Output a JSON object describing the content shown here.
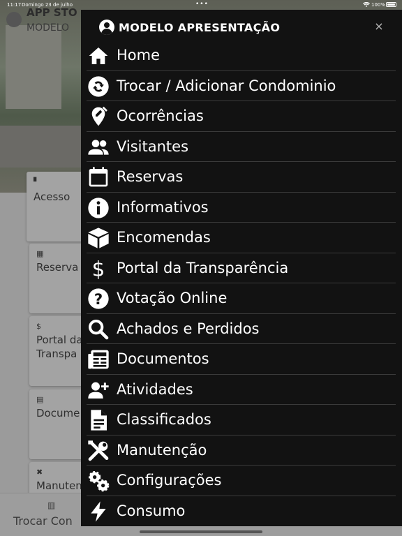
{
  "status_bar": {
    "time": "11:17",
    "date": "Domingo 23 de julho",
    "dots": "•••",
    "battery": "100%"
  },
  "background": {
    "app_title": "APP STO",
    "subtitle": "MODELO",
    "cards": [
      {
        "icon": "door-icon",
        "label": "Acesso"
      },
      {
        "icon": "calendar-icon",
        "label": "Reserva"
      },
      {
        "icon": "dollar-icon",
        "label": "Portal da\nTranspa"
      },
      {
        "icon": "document-icon",
        "label": "Docume"
      },
      {
        "icon": "tools-icon",
        "label": "Manuten"
      }
    ],
    "bottom_bar": {
      "label": "Trocar Con",
      "icon": "buildings-icon"
    }
  },
  "drawer": {
    "title": "MODELO APRESENTAÇÃO",
    "close": "×",
    "items": [
      {
        "label": "Home",
        "icon": "home-icon"
      },
      {
        "label": "Trocar / Adicionar Condominio",
        "icon": "swap-icon"
      },
      {
        "label": "Ocorrências",
        "icon": "location-edit-icon"
      },
      {
        "label": "Visitantes",
        "icon": "people-icon"
      },
      {
        "label": "Reservas",
        "icon": "calendar-icon"
      },
      {
        "label": "Informativos",
        "icon": "info-icon"
      },
      {
        "label": "Encomendas",
        "icon": "package-icon"
      },
      {
        "label": "Portal da Transparência",
        "icon": "dollar-icon"
      },
      {
        "label": "Votação Online",
        "icon": "question-icon"
      },
      {
        "label": "Achados e Perdidos",
        "icon": "search-icon"
      },
      {
        "label": "Documentos",
        "icon": "newspaper-icon"
      },
      {
        "label": "Atividades",
        "icon": "add-person-icon"
      },
      {
        "label": "Classificados",
        "icon": "file-document-icon"
      },
      {
        "label": "Manutenção",
        "icon": "tools-icon"
      },
      {
        "label": "Configurações",
        "icon": "gears-icon"
      },
      {
        "label": "Consumo",
        "icon": "lightning-icon"
      }
    ]
  }
}
